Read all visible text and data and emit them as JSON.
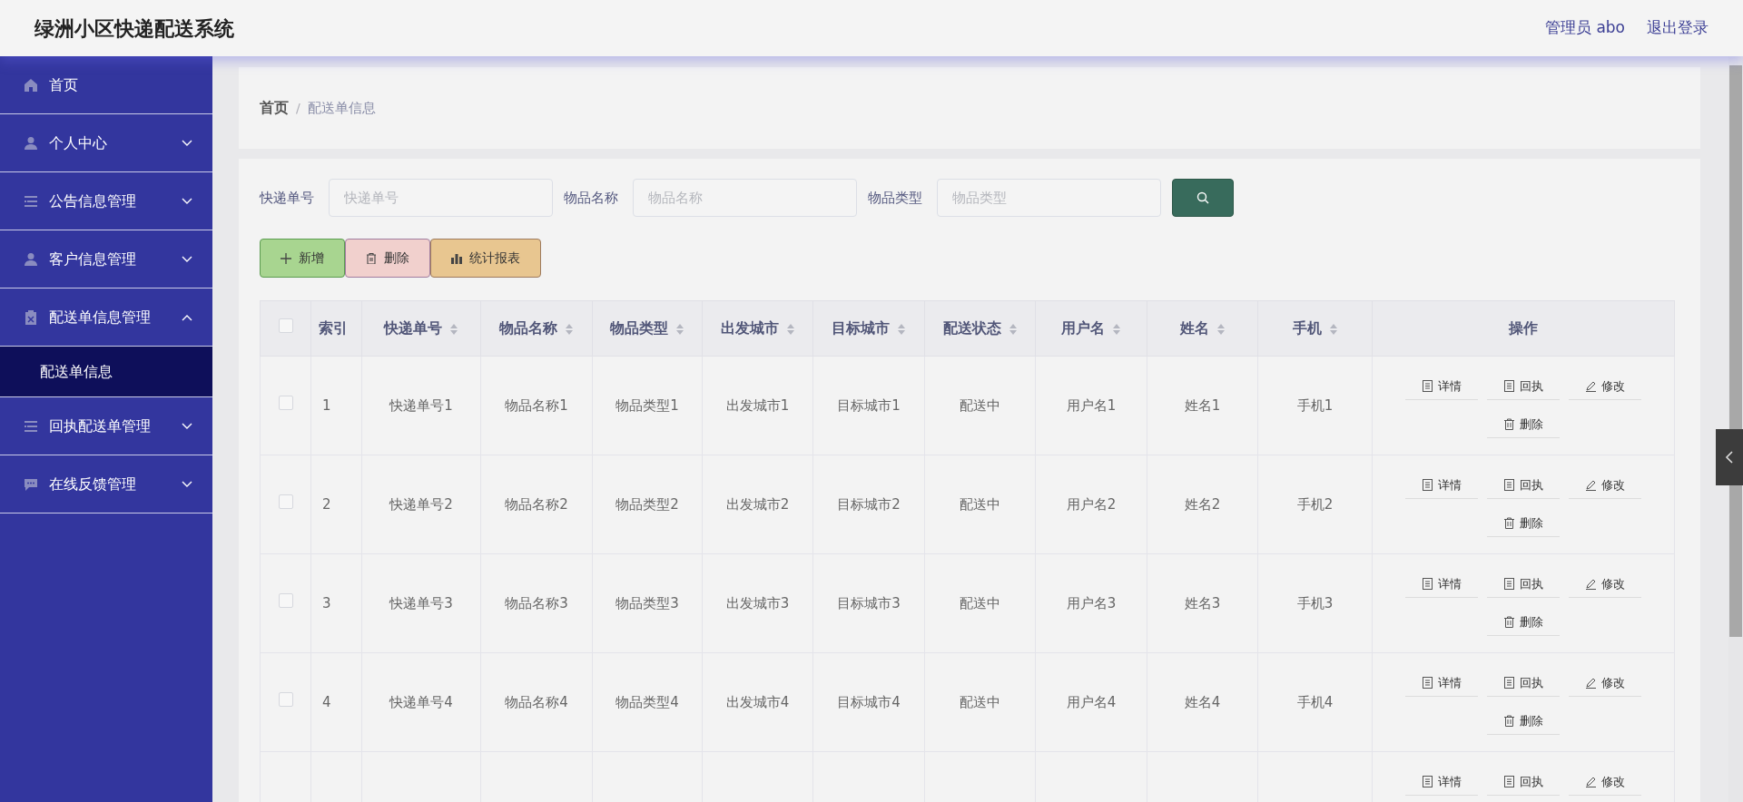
{
  "header": {
    "title": "绿洲小区快递配送系统",
    "user": "管理员 abo",
    "logout": "退出登录"
  },
  "sidebar": {
    "items": [
      {
        "kind": "link",
        "label": "首页"
      },
      {
        "kind": "menu",
        "label": "个人中心",
        "expanded": false
      },
      {
        "kind": "menu",
        "label": "公告信息管理",
        "expanded": false
      },
      {
        "kind": "menu",
        "label": "客户信息管理",
        "expanded": false
      },
      {
        "kind": "menu",
        "label": "配送单信息管理",
        "expanded": true,
        "children": [
          {
            "label": "配送单信息",
            "selected": true
          }
        ]
      },
      {
        "kind": "menu",
        "label": "回执配送单管理",
        "expanded": false
      },
      {
        "kind": "menu",
        "label": "在线反馈管理",
        "expanded": false
      }
    ]
  },
  "breadcrumb": {
    "separator": "/",
    "items": [
      "首页",
      "配送单信息"
    ]
  },
  "search": {
    "fields": [
      {
        "label": "快递单号",
        "placeholder": "快递单号"
      },
      {
        "label": "物品名称",
        "placeholder": "物品名称"
      },
      {
        "label": "物品类型",
        "placeholder": "物品类型"
      }
    ]
  },
  "toolbar": [
    {
      "kind": "add",
      "label": "新增"
    },
    {
      "kind": "delete",
      "label": "删除"
    },
    {
      "kind": "report",
      "label": "统计报表"
    }
  ],
  "table": {
    "select_all": {
      "checked": false
    },
    "columns": [
      {
        "label": "索引",
        "sortable": false
      },
      {
        "label": "快递单号",
        "sortable": true
      },
      {
        "label": "物品名称",
        "sortable": true
      },
      {
        "label": "物品类型",
        "sortable": true
      },
      {
        "label": "出发城市",
        "sortable": true
      },
      {
        "label": "目标城市",
        "sortable": true
      },
      {
        "label": "配送状态",
        "sortable": true
      },
      {
        "label": "用户名",
        "sortable": true
      },
      {
        "label": "姓名",
        "sortable": true
      },
      {
        "label": "手机",
        "sortable": true
      },
      {
        "label": "操作",
        "sortable": false
      }
    ],
    "rows": [
      {
        "checked": false,
        "cells": [
          "1",
          "快递单号1",
          "物品名称1",
          "物品类型1",
          "出发城市1",
          "目标城市1",
          "配送中",
          "用户名1",
          "姓名1",
          "手机1"
        ],
        "actions": [
          {
            "kind": "detail",
            "label": "详情"
          },
          {
            "kind": "receipt",
            "label": "回执"
          },
          {
            "kind": "edit",
            "label": "修改"
          },
          {
            "kind": "delete",
            "label": "删除"
          }
        ]
      },
      {
        "checked": false,
        "cells": [
          "2",
          "快递单号2",
          "物品名称2",
          "物品类型2",
          "出发城市2",
          "目标城市2",
          "配送中",
          "用户名2",
          "姓名2",
          "手机2"
        ],
        "actions": [
          {
            "kind": "detail",
            "label": "详情"
          },
          {
            "kind": "receipt",
            "label": "回执"
          },
          {
            "kind": "edit",
            "label": "修改"
          },
          {
            "kind": "delete",
            "label": "删除"
          }
        ]
      },
      {
        "checked": false,
        "cells": [
          "3",
          "快递单号3",
          "物品名称3",
          "物品类型3",
          "出发城市3",
          "目标城市3",
          "配送中",
          "用户名3",
          "姓名3",
          "手机3"
        ],
        "actions": [
          {
            "kind": "detail",
            "label": "详情"
          },
          {
            "kind": "receipt",
            "label": "回执"
          },
          {
            "kind": "edit",
            "label": "修改"
          },
          {
            "kind": "delete",
            "label": "删除"
          }
        ]
      },
      {
        "checked": false,
        "cells": [
          "4",
          "快递单号4",
          "物品名称4",
          "物品类型4",
          "出发城市4",
          "目标城市4",
          "配送中",
          "用户名4",
          "姓名4",
          "手机4"
        ],
        "actions": [
          {
            "kind": "detail",
            "label": "详情"
          },
          {
            "kind": "receipt",
            "label": "回执"
          },
          {
            "kind": "edit",
            "label": "修改"
          },
          {
            "kind": "delete",
            "label": "删除"
          }
        ]
      },
      {
        "actions": [
          {
            "kind": "detail",
            "label": "详情"
          },
          {
            "kind": "receipt",
            "label": "回执"
          },
          {
            "kind": "edit",
            "label": "修改"
          }
        ]
      }
    ]
  }
}
